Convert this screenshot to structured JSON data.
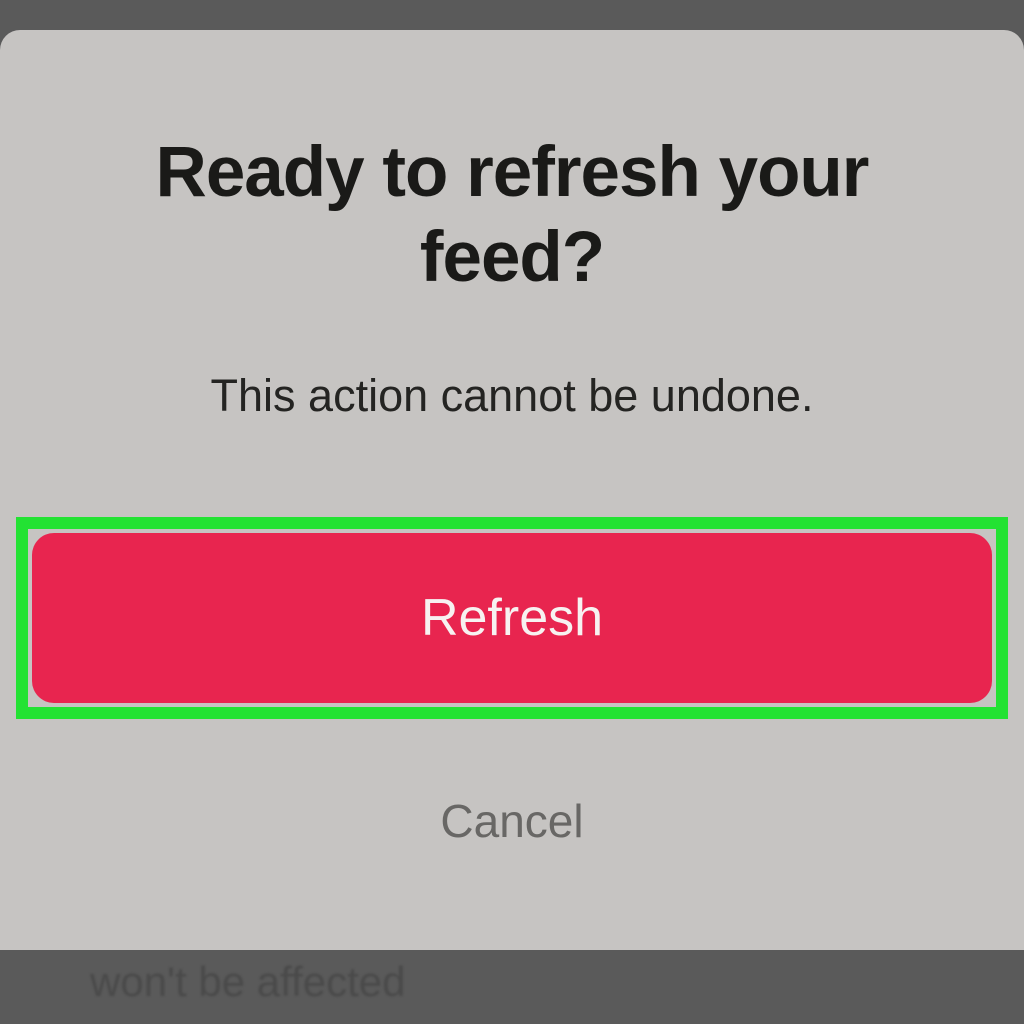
{
  "dialog": {
    "title": "Ready to refresh your feed?",
    "subtitle": "This action cannot be undone.",
    "refresh_label": "Refresh",
    "cancel_label": "Cancel"
  },
  "background": {
    "partial_text": "won't be affected"
  },
  "colors": {
    "highlight": "#23e233",
    "primary_button": "#e8254f",
    "dialog_bg": "#c6c4c2"
  }
}
